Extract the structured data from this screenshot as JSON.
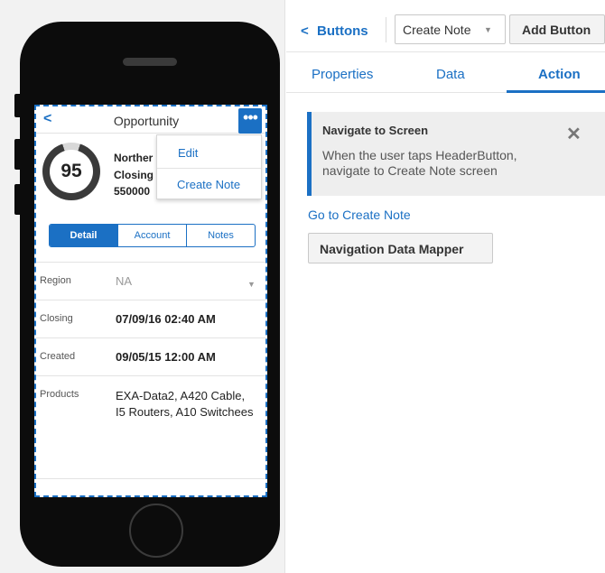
{
  "colors": {
    "accent": "#1b70c4",
    "gauge_dark": "#3a3a3a",
    "gauge_light": "#d8d8d8"
  },
  "phone": {
    "header": {
      "back_icon": "chevron-left-icon",
      "back_glyph": "<",
      "title": "Opportunity",
      "more_icon": "more-icon",
      "more_glyph": "•••"
    },
    "gauge": {
      "value": "95",
      "fraction": 0.9
    },
    "summary": {
      "line1": "Norther",
      "line2": "Closing",
      "line3": "550000"
    },
    "menu": {
      "items": [
        "Edit",
        "Create Note"
      ]
    },
    "segments": {
      "items": [
        "Detail",
        "Account",
        "Notes"
      ],
      "active": "Detail"
    },
    "rows": [
      {
        "label": "Region",
        "value": "NA"
      },
      {
        "label": "Closing",
        "value": "07/09/16 02:40 AM"
      },
      {
        "label": "Created",
        "value": "09/05/15 12:00 AM"
      },
      {
        "label": "Products",
        "value_line1": "EXA-Data2, A420 Cable,",
        "value_line2": "I5 Routers, A10 Switchees"
      }
    ]
  },
  "panel": {
    "back": {
      "icon": "chevron-left-icon",
      "glyph": "<",
      "label": "Buttons"
    },
    "select": {
      "value": "Create Note",
      "caret_icon": "caret-down-icon",
      "caret_glyph": "▼"
    },
    "add_button_label": "Add Button",
    "tabs": [
      "Properties",
      "Data",
      "Action"
    ],
    "active_tab": "Action",
    "info": {
      "title": "Navigate to Screen",
      "text": "When the user taps HeaderButton, navigate to Create Note screen",
      "close_icon": "close-icon",
      "close_glyph": "✕"
    },
    "link": "Go to Create Note",
    "mapper_button_label": "Navigation Data Mapper"
  }
}
